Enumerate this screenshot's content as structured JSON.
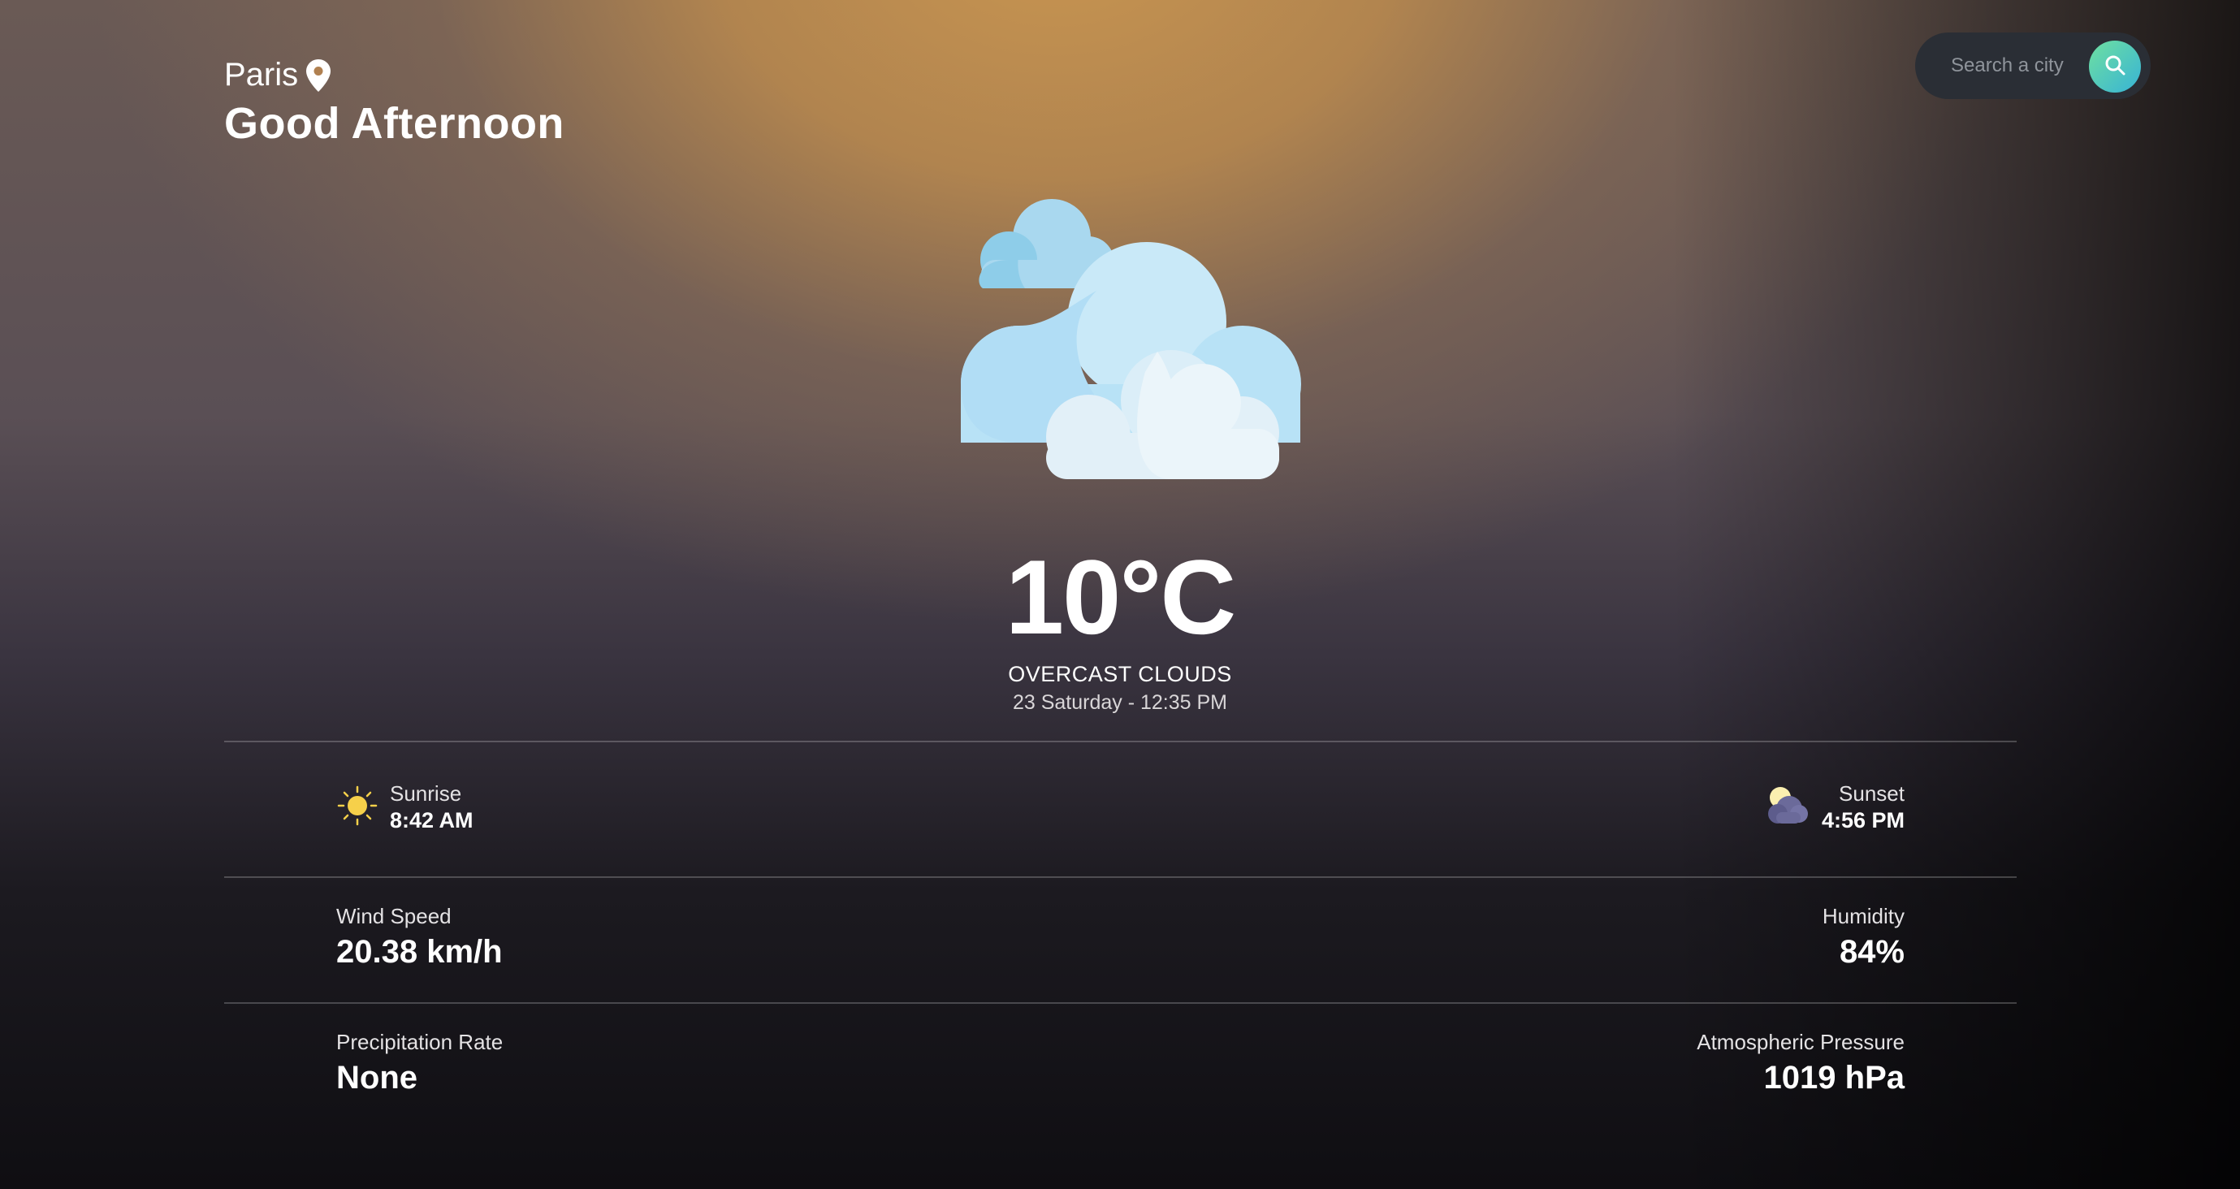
{
  "header": {
    "city": "Paris",
    "greeting": "Good Afternoon",
    "location_icon": "map-pin-icon"
  },
  "search": {
    "placeholder": "Search a city",
    "button_icon": "search-icon"
  },
  "current": {
    "temperature": "10°C",
    "description": "OVERCAST CLOUDS",
    "datetime": "23 Saturday - 12:35 PM",
    "weather_icon": "overcast-clouds-icon"
  },
  "sun": {
    "sunrise_label": "Sunrise",
    "sunrise_time": "8:42 AM",
    "sunset_label": "Sunset",
    "sunset_time": "4:56 PM"
  },
  "details": {
    "wind_label": "Wind Speed",
    "wind_value": "20.38 km/h",
    "humidity_label": "Humidity",
    "humidity_value": "84%",
    "precip_label": "Precipitation Rate",
    "precip_value": "None",
    "pressure_label": "Atmospheric Pressure",
    "pressure_value": "1019 hPa"
  },
  "colors": {
    "accent_gradient_start": "#6fe0a0",
    "accent_gradient_end": "#37b3d6",
    "sun_yellow": "#f6d04a"
  }
}
